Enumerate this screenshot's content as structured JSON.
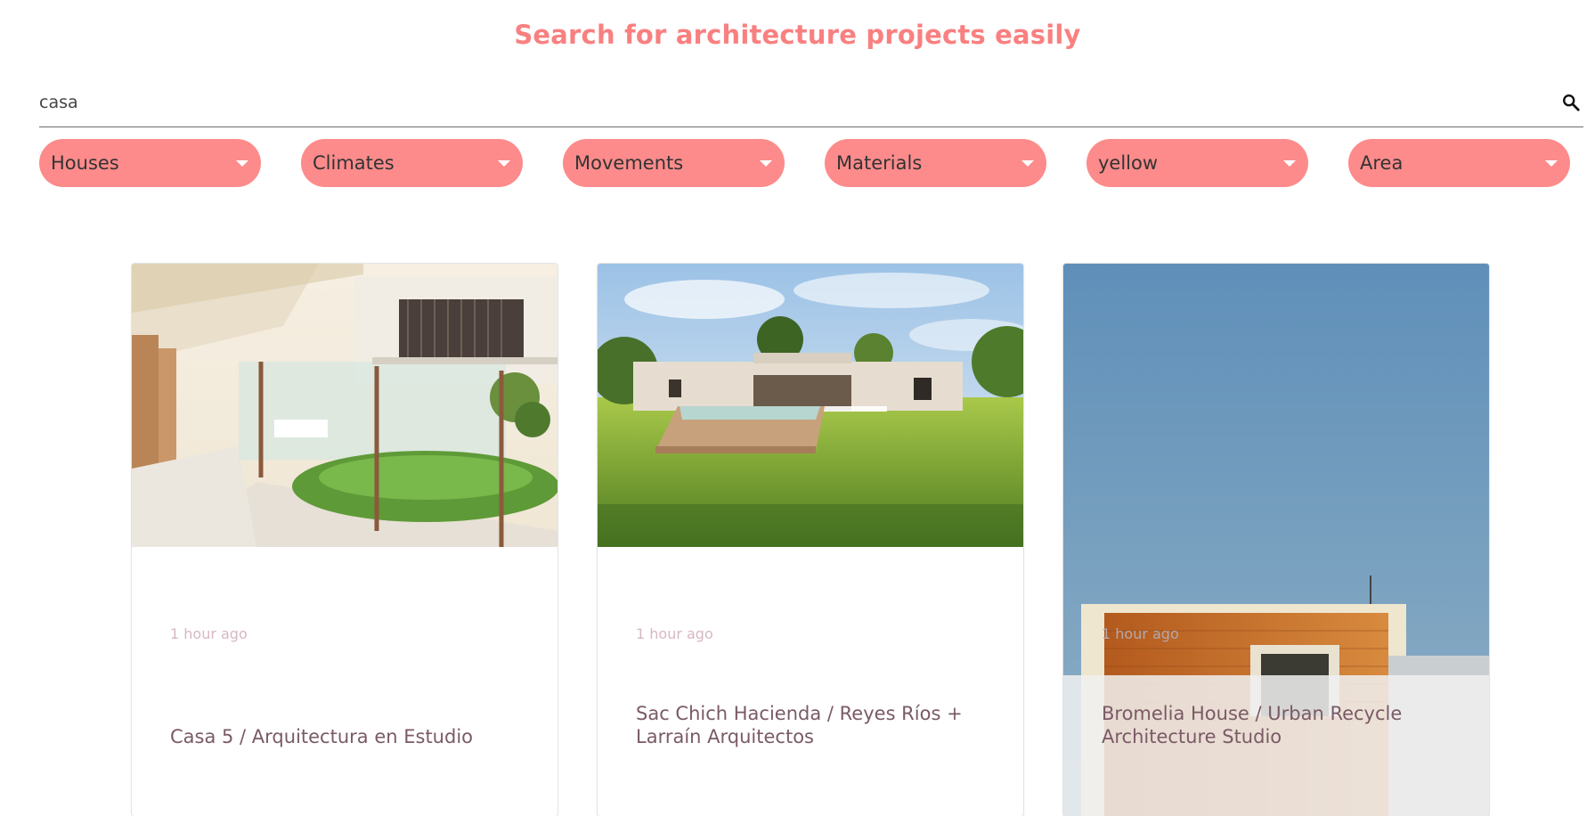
{
  "header": {
    "title": "Search for architecture projects easily"
  },
  "search": {
    "value": "casa",
    "icon": "search-icon"
  },
  "filters": [
    {
      "label": "Houses"
    },
    {
      "label": "Climates"
    },
    {
      "label": "Movements"
    },
    {
      "label": "Materials"
    },
    {
      "label": "yellow"
    },
    {
      "label": "Area"
    }
  ],
  "colors": {
    "accent": "#f98080",
    "pill": "#fd8b8b",
    "title_text": "#7a5a66",
    "time_text": "#d7b8c0"
  },
  "cards": [
    {
      "title": "Casa 5 / Arquitectura en Estudio",
      "time": "1 hour ago"
    },
    {
      "title": "Sac Chich Hacienda / Reyes Ríos + Larraín Arquitectos",
      "time": "1 hour ago"
    },
    {
      "title": "Bromelia House / Urban Recycle Architecture Studio",
      "time": "1 hour ago"
    }
  ]
}
